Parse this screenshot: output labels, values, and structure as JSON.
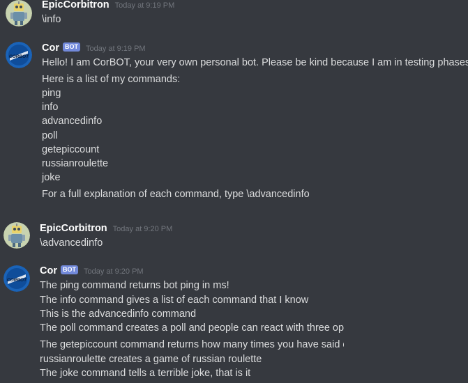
{
  "messages": [
    {
      "author": "EpicCorbitron",
      "timestamp": "Today at 9:19 PM",
      "lines": [
        "\\info"
      ]
    },
    {
      "author": "Cor",
      "bot_tag": "BOT",
      "timestamp": "Today at 9:19 PM",
      "lines": [
        "Hello! I am CorBOT, your very own personal bot. Please be kind because I am in testing phases.",
        "Here is a list of my commands:",
        "ping",
        "info",
        "advancedinfo",
        "poll",
        "getepiccount",
        "russianroulette",
        "joke",
        "For a full explanation of each command, type \\advancedinfo"
      ]
    },
    {
      "author": "EpicCorbitron",
      "timestamp": "Today at 9:20 PM",
      "lines": [
        "\\advancedinfo"
      ]
    },
    {
      "author": "Cor",
      "bot_tag": "BOT",
      "timestamp": "Today at 9:20 PM",
      "lines": [
        "The ping command returns bot ping in ms!",
        "The info command gives a list of each command that I know",
        "This is the advancedinfo command",
        "The poll command creates a poll and people can react with three optic",
        "The getepiccount command returns how many times you have said ep",
        "russianroulette creates a game of russian roulette",
        "The joke command tells a terrible joke, that is it"
      ]
    }
  ],
  "avatars": {
    "user_icon": "robot-avatar-icon",
    "bot_icon": "corbot-logo-icon",
    "bot_logo_text": "CORBOT",
    "user_bg": "#c8d3b0",
    "bot_bg": "#1a63b8"
  }
}
